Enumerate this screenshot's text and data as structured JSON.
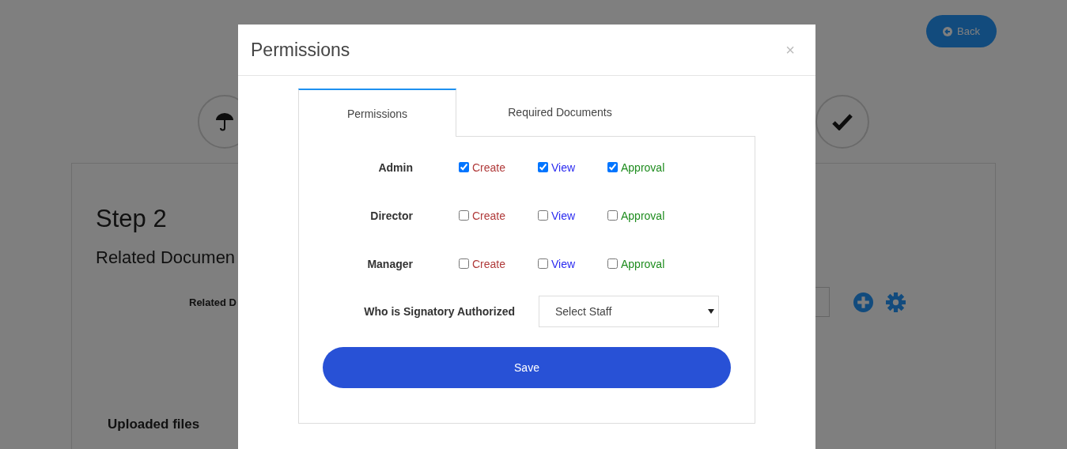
{
  "background_page": {
    "back_button": "Back",
    "step_title": "Step 2",
    "section_title": "Related Documen",
    "field_label": "Related D",
    "uploaded_heading": "Uploaded files"
  },
  "modal": {
    "title": "Permissions",
    "close": "×",
    "tabs": [
      {
        "label": "Permissions",
        "selected": true
      },
      {
        "label": "Required Documents",
        "selected": false
      }
    ],
    "roles": [
      {
        "name": "Admin",
        "permissions": [
          {
            "label": "Create",
            "checked": true,
            "color": "#b03a3a"
          },
          {
            "label": "View",
            "checked": true,
            "color": "#2a2af0"
          },
          {
            "label": "Approval",
            "checked": true,
            "color": "#1e8c1e"
          }
        ]
      },
      {
        "name": "Director",
        "permissions": [
          {
            "label": "Create",
            "checked": false,
            "color": "#b03a3a"
          },
          {
            "label": "View",
            "checked": false,
            "color": "#2a2af0"
          },
          {
            "label": "Approval",
            "checked": false,
            "color": "#1e8c1e"
          }
        ]
      },
      {
        "name": "Manager",
        "permissions": [
          {
            "label": "Create",
            "checked": false,
            "color": "#b03a3a"
          },
          {
            "label": "View",
            "checked": false,
            "color": "#2a2af0"
          },
          {
            "label": "Approval",
            "checked": false,
            "color": "#1e8c1e"
          }
        ]
      }
    ],
    "signatory": {
      "label": "Who is Signatory Authorized",
      "placeholder": "Select Staff"
    },
    "save_button": "Save"
  }
}
